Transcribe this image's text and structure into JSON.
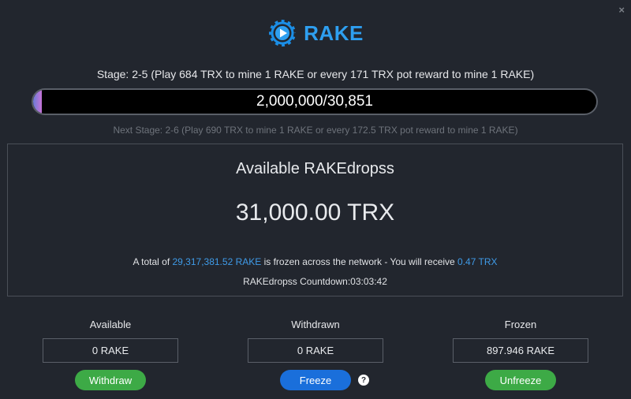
{
  "window": {
    "close_icon": "×"
  },
  "logo": {
    "icon": "poker-chip-play-icon",
    "text": "RAKE",
    "color": "#2e9ff0"
  },
  "stage": {
    "current": "Stage: 2-5 (Play 684 TRX to mine 1 RAKE or every 171 TRX pot reward to mine 1 RAKE)",
    "next": "Next Stage: 2-6 (Play 690 TRX to mine 1 RAKE or every 172.5 TRX pot reward to mine 1 RAKE)",
    "progress_text": "2,000,000/30,851",
    "progress_fraction": 0.0154
  },
  "dropsPanel": {
    "title": "Available RAKEdropss",
    "amount": "31,000.00 TRX",
    "info_prefix": "A total of ",
    "frozen_total": "29,317,381.52 RAKE",
    "info_middle": " is frozen across the network - You will receive ",
    "receive": "0.47 TRX",
    "countdown": "RAKEdropss Countdown:03:03:42"
  },
  "columns": {
    "available": {
      "label": "Available",
      "value": "0 RAKE",
      "button": "Withdraw"
    },
    "withdrawn": {
      "label": "Withdrawn",
      "value": "0 RAKE",
      "button": "Freeze",
      "help": "?"
    },
    "frozen": {
      "label": "Frozen",
      "value": "897.946 RAKE",
      "button": "Unfreeze"
    }
  },
  "colors": {
    "background": "#22262e",
    "accent": "#3f9be8",
    "green": "#3daa46",
    "blue": "#1a6fdb"
  }
}
